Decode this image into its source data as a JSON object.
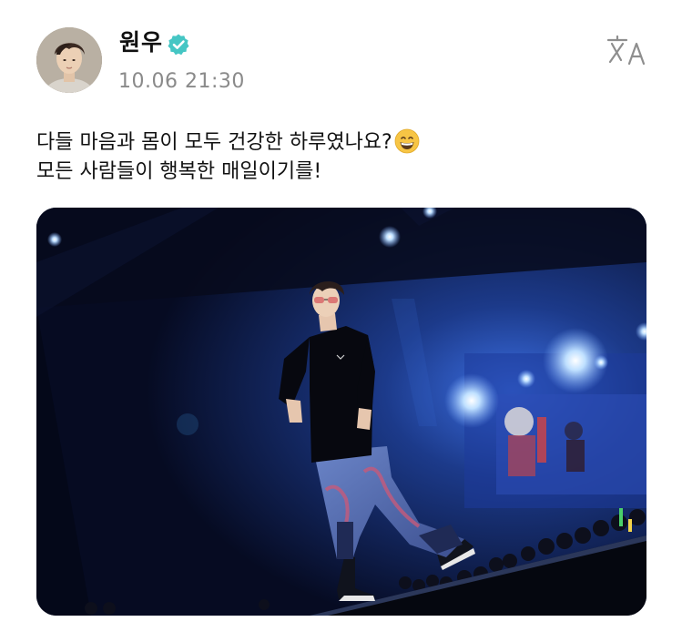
{
  "post": {
    "author": {
      "name": "원우",
      "verified": true,
      "avatar_icon": "profile-avatar",
      "verified_icon": "verified-check-icon"
    },
    "timestamp": "10.06 21:30",
    "translate_icon": "translate-icon",
    "text_lines": [
      "다들 마음과 몸이 모두 건강한 하루였나요?",
      "모든 사람들이 행복한 매일이기를!"
    ],
    "emoji": "grinning-face-emoji",
    "photo_icon": "concert-stage-photo",
    "colors": {
      "verified_badge": "#45c6c4",
      "timestamp_text": "#8a8a8a",
      "icon_gray": "#8e8e8e",
      "photo_background": "#0a1230"
    }
  }
}
